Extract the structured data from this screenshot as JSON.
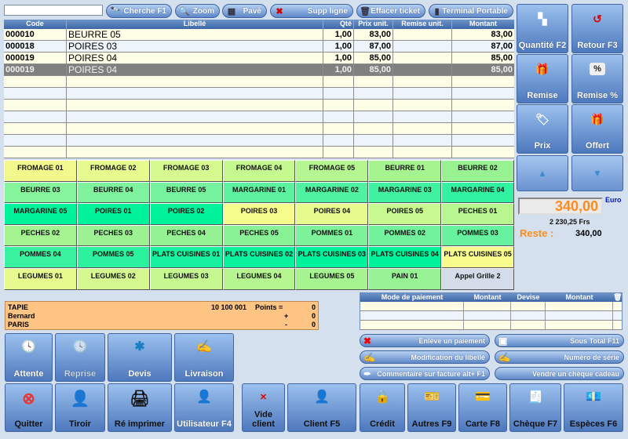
{
  "toolbar": {
    "search_value": "",
    "buttons": [
      {
        "label": "Cherche F1",
        "icon": "binoculars"
      },
      {
        "label": "Zoom",
        "icon": "magnifier"
      },
      {
        "label": "Pavé",
        "icon": "keypad"
      },
      {
        "label": "Supp ligne",
        "icon": "red-x"
      },
      {
        "label": "Effacer ticket",
        "icon": "trash"
      },
      {
        "label": "Terminal Portable",
        "icon": "handheld"
      }
    ]
  },
  "ticket": {
    "columns": [
      "Code",
      "Libellé",
      "Qté",
      "Prix unit.",
      "Remise unit.",
      "Montant"
    ],
    "rows": [
      {
        "code": "000010",
        "label": "BEURRE 05",
        "qty": "1,00",
        "price": "83,00",
        "discount": "",
        "amount": "83,00"
      },
      {
        "code": "000018",
        "label": "POIRES 03",
        "qty": "1,00",
        "price": "87,00",
        "discount": "",
        "amount": "87,00"
      },
      {
        "code": "000019",
        "label": "POIRES 04",
        "qty": "1,00",
        "price": "85,00",
        "discount": "",
        "amount": "85,00"
      },
      {
        "code": "000019",
        "label": "POIRES 04",
        "qty": "1,00",
        "price": "85,00",
        "discount": "",
        "amount": "85,00",
        "selected": true
      }
    ],
    "empty_rows": 7
  },
  "side": {
    "quantite": "Quantité F2",
    "retour": "Retour F3",
    "remise": "Remise",
    "remise_pct": "Remise %",
    "prix": "Prix",
    "offert": "Offert"
  },
  "totals": {
    "total": "340,00",
    "currency": "Euro",
    "francs": "2 230,25  Frs",
    "reste_label": "Reste :",
    "reste_value": "340,00"
  },
  "products": [
    "FROMAGE 01",
    "FROMAGE 02",
    "FROMAGE 03",
    "FROMAGE 04",
    "FROMAGE 05",
    "BEURRE 01",
    "BEURRE 02",
    "BEURRE 03",
    "BEURRE 04",
    "BEURRE 05",
    "MARGARINE 01",
    "MARGARINE 02",
    "MARGARINE 03",
    "MARGARINE 04",
    "MARGARINE 05",
    "POIRES 01",
    "POIRES 02",
    "POIRES 03",
    "POIRES 04",
    "POIRES 05",
    "PECHES 01",
    "PECHES 02",
    "PECHES 03",
    "PECHES 04",
    "PECHES 05",
    "POMMES 01",
    "POMMES 02",
    "POMMES 03",
    "POMMES 04",
    "POMMES 05",
    "PLATS CUISINES 01",
    "PLATS CUISINES 02",
    "PLATS CUISINES 03",
    "PLATS CUISINES 04",
    "PLATS CUISINES 05",
    "LEGUMES 01",
    "LEGUMES 02",
    "LEGUMES 03",
    "LEGUMES 04",
    "LEGUMES 05",
    "PAIN 01",
    "Appel Grille 2"
  ],
  "product_colors": [
    "#f3f88c",
    "#e6fa8e",
    "#d6fa90",
    "#c6f890",
    "#b6f690",
    "#a6f490",
    "#98f292",
    "#86f49a",
    "#7ef29c",
    "#76f29e",
    "#5cf2a0",
    "#4ef2a0",
    "#40f2a0",
    "#30f2a0",
    "#00f29a",
    "#00f29a",
    "#00f29a",
    "#f6fc8c",
    "#e6fa8e",
    "#c8f890",
    "#b8f690",
    "#a4f492",
    "#9cf292",
    "#94f292",
    "#8af296",
    "#7ef29a",
    "#72f29c",
    "#66f29e",
    "#38f2a0",
    "#2cf2a0",
    "#18f2a0",
    "#0af29e",
    "#00f29a",
    "#00f29a",
    "#f8fc8c",
    "#e6fa8e",
    "#d6f890",
    "#c6f890",
    "#b6f690",
    "#a6f490",
    "#96f292",
    "#d4dcea"
  ],
  "client": {
    "last_name": "TAPIE",
    "first_name": "Bernard",
    "city": "PARIS",
    "number": "10 100 001",
    "points_label": "Points =",
    "plus_label": "+",
    "minus_label": "-",
    "points": "0",
    "plus": "0",
    "minus": "0"
  },
  "payments": {
    "columns": [
      "Mode de paiement",
      "Montant",
      "Devise",
      "Montant"
    ]
  },
  "actions": {
    "enleve": "Enlève un paiement",
    "sous_total": "Sous Total F11",
    "modif_libelle": "Modification du libellé",
    "numero_serie": "Numéro de série",
    "commentaire": "Commentaire sur facture alt+ F1",
    "cheque_cadeau": "Vendre un chèque cadeau"
  },
  "bottom": {
    "attente": "Attente",
    "reprise": "Reprise",
    "devis": "Devis",
    "livraison": "Livraison",
    "quitter": "Quitter",
    "tiroir": "Tiroir",
    "reimprimer": "Ré imprimer",
    "utilisateur": "Utilisateur F4",
    "vide_client_1": "Vide",
    "vide_client_2": "client",
    "client": "Client F5",
    "credit": "Crédit",
    "autres": "Autres F9",
    "carte": "Carte F8",
    "cheque": "Chèque F7",
    "especes": "Espèces F6"
  }
}
